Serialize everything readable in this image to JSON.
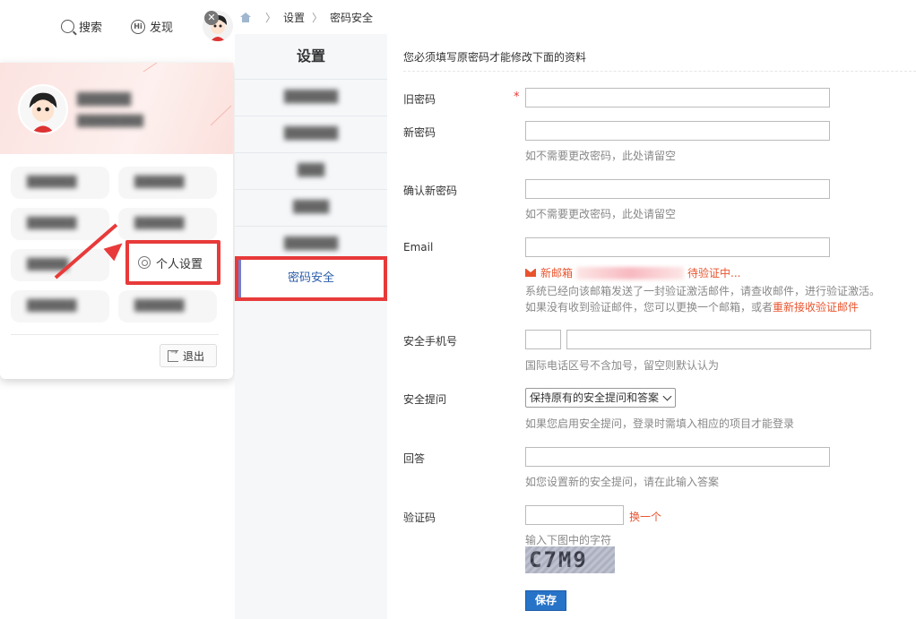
{
  "topnav": {
    "search_label": "搜索",
    "discover_label": "发现"
  },
  "user_menu": {
    "personal_settings_label": "个人设置",
    "logout_label": "退出"
  },
  "breadcrumb": [
    "设置",
    "密码安全"
  ],
  "side_nav": {
    "title": "设置",
    "active_item": "密码安全"
  },
  "form": {
    "notice": "您必须填写原密码才能修改下面的资料",
    "old_password_label": "旧密码",
    "required_mark": "*",
    "new_password_label": "新密码",
    "new_password_hint": "如不需要更改密码，此处请留空",
    "confirm_password_label": "确认新密码",
    "confirm_password_hint": "如不需要更改密码，此处请留空",
    "email_label": "Email",
    "email_warn_prefix": "新邮箱",
    "email_warn_suffix": "待验证中...",
    "email_info_1": "系统已经向该邮箱发送了一封验证激活邮件，请查收邮件，进行验证激活。",
    "email_info_2_prefix": "如果没有收到验证邮件，您可以更换一个邮箱，或者",
    "email_info_2_link": "重新接收验证邮件",
    "phone_label": "安全手机号",
    "phone_hint": "国际电话区号不含加号，留空则默认认为",
    "question_label": "安全提问",
    "question_selected": "保持原有的安全提问和答案",
    "question_hint": "如果您启用安全提问，登录时需填入相应的项目才能登录",
    "answer_label": "回答",
    "answer_hint": "如您设置新的安全提问，请在此输入答案",
    "captcha_label": "验证码",
    "captcha_refresh": "换一个",
    "captcha_hint": "输入下图中的字符",
    "captcha_image_text": "C7M9",
    "save_label": "保存"
  },
  "colors": {
    "highlight_red": "#e83a3a",
    "link_red": "#e8542e",
    "primary_blue": "#2673c8",
    "active_text": "#2a5caa"
  }
}
